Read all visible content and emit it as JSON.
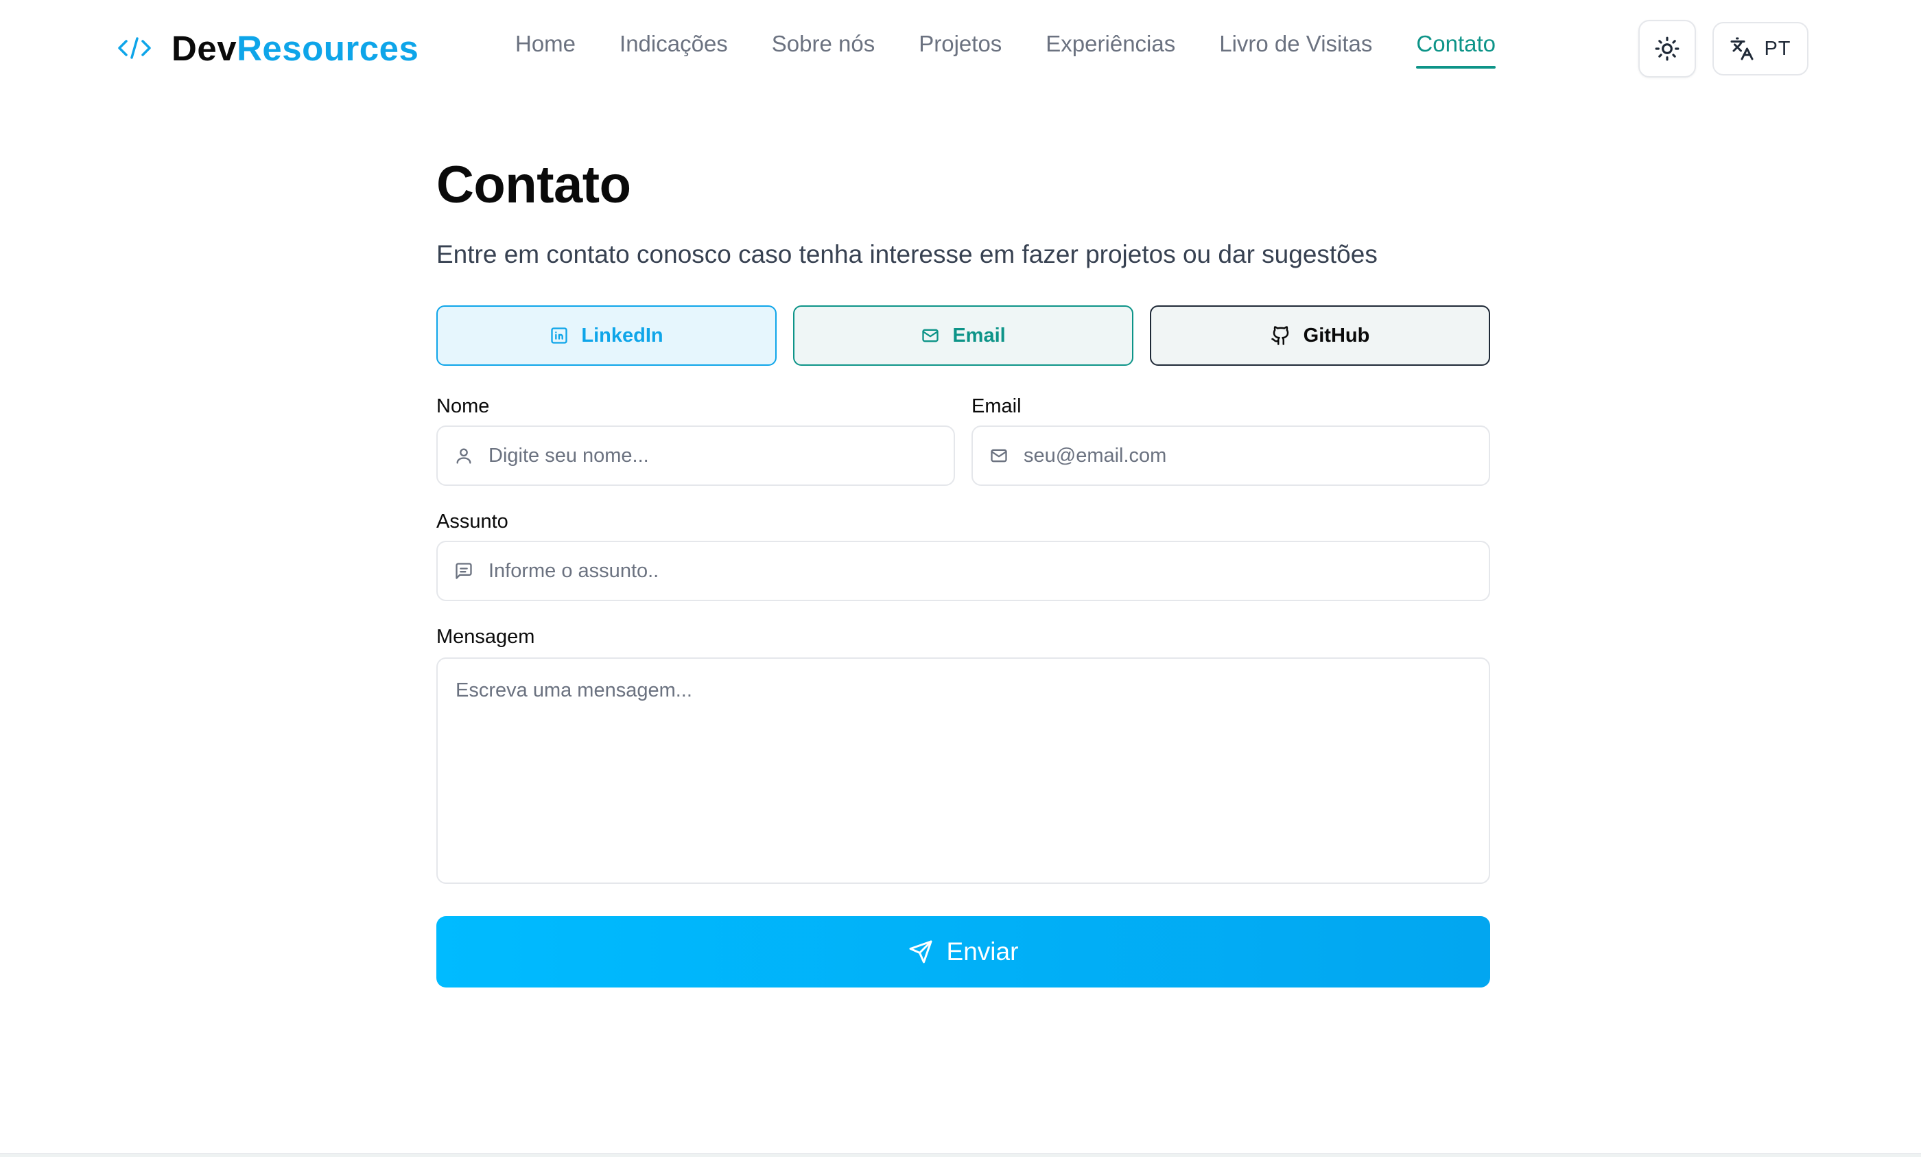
{
  "brand": {
    "part1": "Dev",
    "part2": "Resources",
    "icon": "code-icon"
  },
  "nav": {
    "items": [
      {
        "label": "Home"
      },
      {
        "label": "Indicações"
      },
      {
        "label": "Sobre nós"
      },
      {
        "label": "Projetos"
      },
      {
        "label": "Experiências"
      },
      {
        "label": "Livro de Visitas"
      },
      {
        "label": "Contato"
      }
    ],
    "active": "Contato"
  },
  "header_actions": {
    "theme_icon": "sun-icon",
    "language": {
      "icon": "translate-icon",
      "label": "PT"
    }
  },
  "page": {
    "title": "Contato",
    "subtitle": "Entre em contato conosco caso tenha interesse em fazer projetos ou dar sugestões"
  },
  "socials": [
    {
      "label": "LinkedIn",
      "icon": "linkedin-icon",
      "color": "#0ea5e9"
    },
    {
      "label": "Email",
      "icon": "mail-icon",
      "color": "#0d9488"
    },
    {
      "label": "GitHub",
      "icon": "github-icon",
      "color": "#0a0a0a"
    }
  ],
  "form": {
    "name": {
      "label": "Nome",
      "placeholder": "Digite seu nome...",
      "value": "",
      "icon": "user-icon"
    },
    "email": {
      "label": "Email",
      "placeholder": "seu@email.com",
      "value": "",
      "icon": "mail-icon"
    },
    "subject": {
      "label": "Assunto",
      "placeholder": "Informe o assunto..",
      "value": "",
      "icon": "message-square-icon"
    },
    "message": {
      "label": "Mensagem",
      "placeholder": "Escreva uma mensagem...",
      "value": ""
    },
    "submit": {
      "label": "Enviar",
      "icon": "send-icon"
    }
  },
  "colors": {
    "accent": "#0ea5e9",
    "active_nav": "#0d9488",
    "submit_gradient_start": "#00bbff",
    "submit_gradient_end": "#02a6f0"
  }
}
